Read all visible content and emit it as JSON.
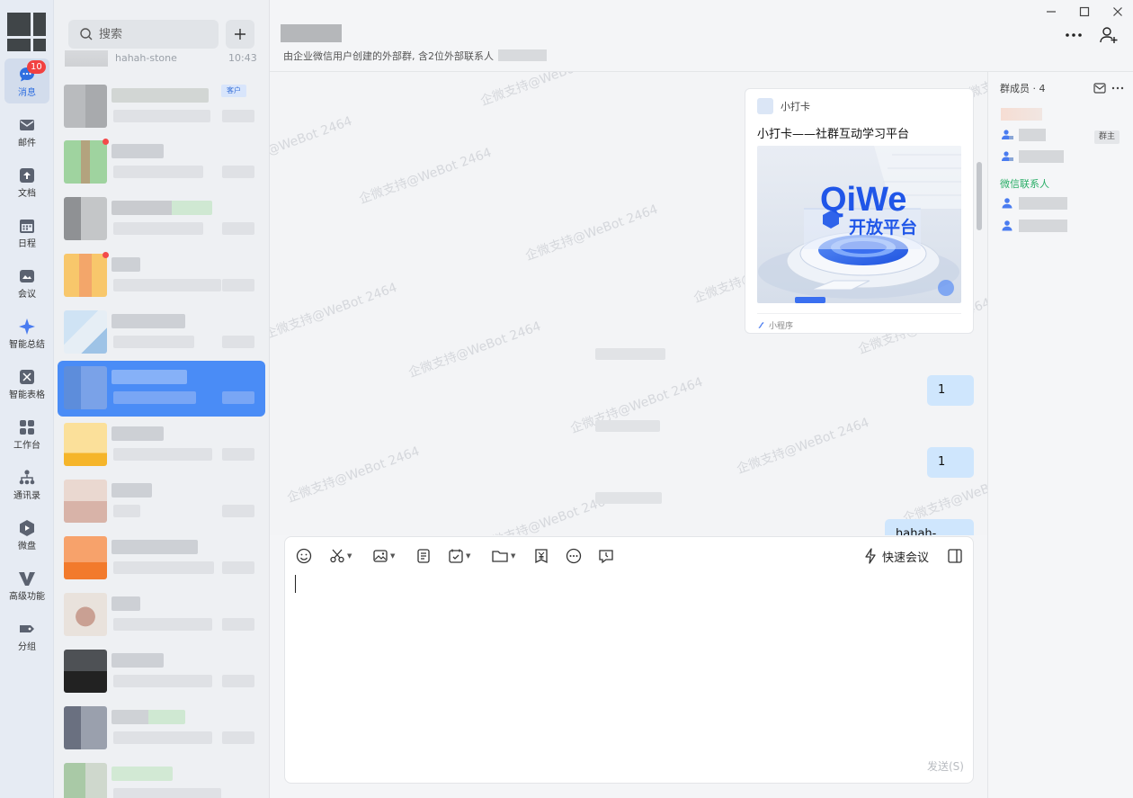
{
  "rail": {
    "badge_count": "10",
    "items": [
      {
        "label": "消息",
        "icon": "message-icon"
      },
      {
        "label": "邮件",
        "icon": "mail-icon"
      },
      {
        "label": "文档",
        "icon": "document-icon"
      },
      {
        "label": "日程",
        "icon": "calendar-icon"
      },
      {
        "label": "会议",
        "icon": "meeting-icon"
      },
      {
        "label": "智能总结",
        "icon": "sparkle-icon"
      },
      {
        "label": "智能表格",
        "icon": "smart-sheet-icon"
      },
      {
        "label": "工作台",
        "icon": "workbench-icon"
      },
      {
        "label": "通讯录",
        "icon": "contacts-icon"
      },
      {
        "label": "微盘",
        "icon": "drive-icon"
      },
      {
        "label": "高级功能",
        "icon": "advanced-icon"
      },
      {
        "label": "分组",
        "icon": "group-tag-icon"
      }
    ]
  },
  "sessions": {
    "search_placeholder": "搜索",
    "top_partial": {
      "name": "hahah-stone",
      "time": "10:43"
    },
    "customer_tag": "客户"
  },
  "header": {
    "subtitle": "由企业微信用户创建的外部群, 含2位外部联系人"
  },
  "chat": {
    "watermark": "企微支持@WeBot 2464",
    "card": {
      "source": "小打卡",
      "title": "小打卡——社群互动学习平台",
      "image_text_line1": "QiWe",
      "image_text_line2": "开放平台",
      "footer": "小程序"
    },
    "bubbles": [
      "1",
      "1",
      "hahah-stone"
    ]
  },
  "members": {
    "title": "群成员 · 4",
    "owner_tag": "群主",
    "wechat_section": "微信联系人"
  },
  "editor": {
    "quick_meeting": "快速会议",
    "send": "发送(S)"
  },
  "colors": {
    "accent": "#4a8cf6",
    "badge": "#f24141",
    "bubble": "#cfe6fd",
    "wechat_green": "#2aae67"
  }
}
